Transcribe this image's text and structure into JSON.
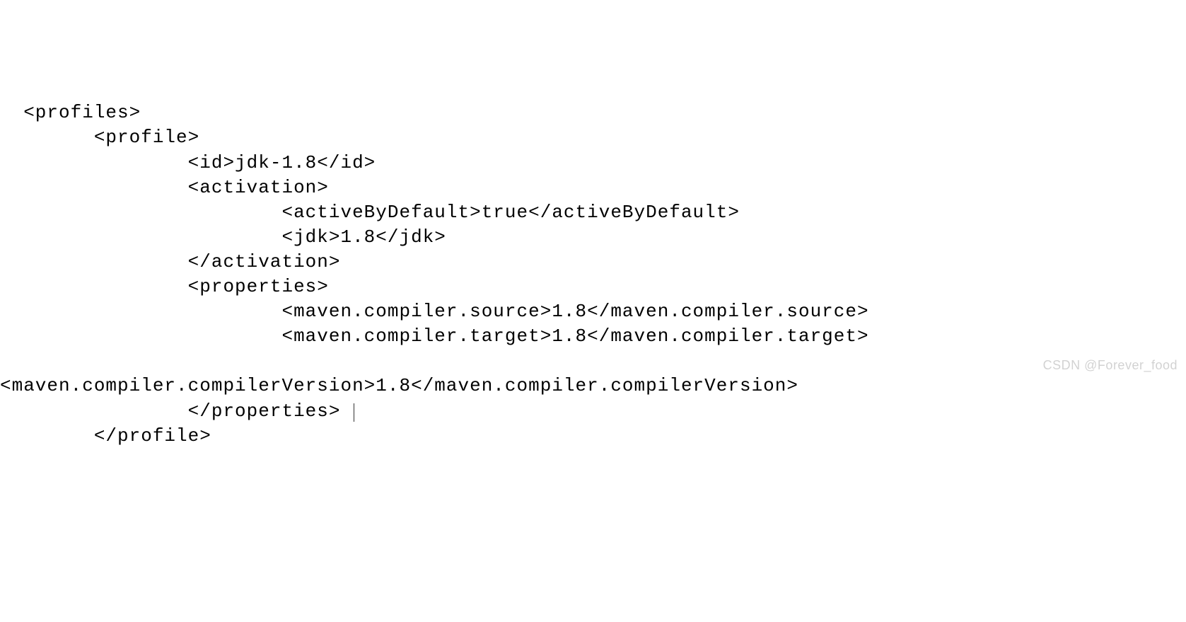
{
  "code": {
    "l1": "  <profiles>",
    "l2": "        <profile>",
    "l3": "                <id>jdk-1.8</id>",
    "l4": "                <activation>",
    "l5": "                        <activeByDefault>true</activeByDefault>",
    "l6": "                        <jdk>1.8</jdk>",
    "l7": "                </activation>",
    "l8": "                <properties>",
    "l9": "                        <maven.compiler.source>1.8</maven.compiler.source>",
    "l10": "                        <maven.compiler.target>1.8</maven.compiler.target>",
    "l11": "",
    "l12": "<maven.compiler.compilerVersion>1.8</maven.compiler.compilerVersion>",
    "l13": "                </properties> ",
    "l14": "        </profile>"
  },
  "watermark": "CSDN @Forever_food"
}
